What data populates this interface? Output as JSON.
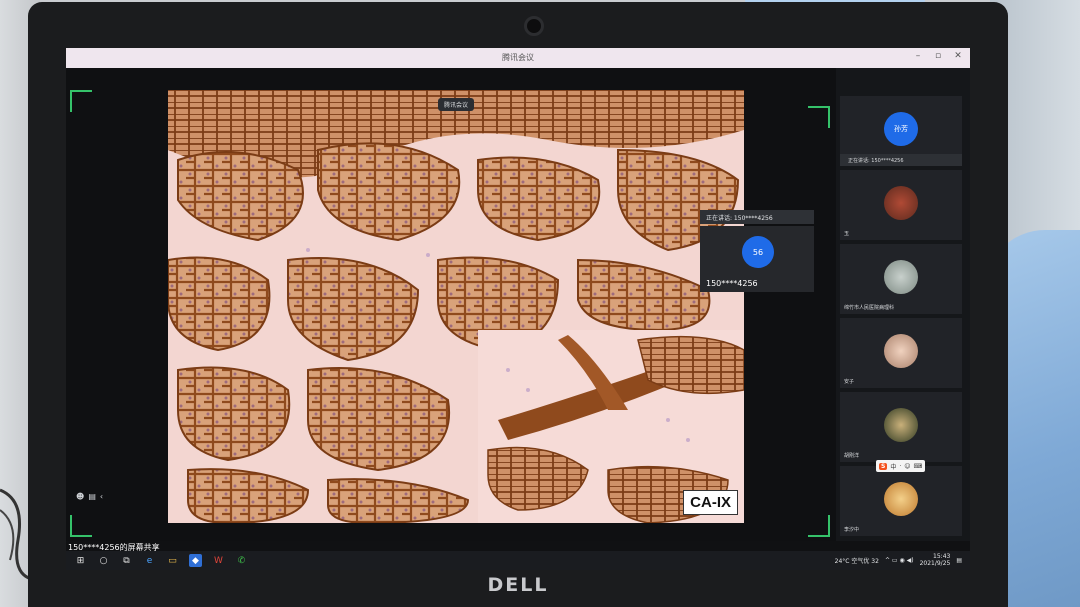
{
  "window": {
    "title": "腾讯会议",
    "controls": [
      "–",
      "▫",
      "✕"
    ]
  },
  "stage": {
    "meeting_chip": "腾讯会议",
    "stain_label": "CA-IX",
    "speaking_bar": "正在讲话: 150****4256",
    "float_tile": {
      "avatar_text": "56",
      "name": "150****4256"
    },
    "left_tools": [
      "☻",
      "▤",
      "‹"
    ]
  },
  "participants": [
    {
      "avatar_text": "孙芳",
      "name": "",
      "speaking": "正在讲话: 150****4256",
      "avatar_color": "#1f6be8"
    },
    {
      "avatar_text": "",
      "name": "玉",
      "speaking": "",
      "avatar_color": "#8a3b2c"
    },
    {
      "avatar_text": "",
      "name": "绵竹市人民医院病理科",
      "speaking": "",
      "avatar_color": "#9aa7a0"
    },
    {
      "avatar_text": "",
      "name": "安子",
      "speaking": "",
      "avatar_color": "#c7a38b"
    },
    {
      "avatar_text": "",
      "name": "胡刚洋",
      "speaking": "",
      "avatar_color": "#3d4a2e"
    },
    {
      "avatar_text": "",
      "name": "李汐中",
      "speaking": "",
      "avatar_color": "#d89b4a"
    }
  ],
  "ime": {
    "logo": "S",
    "items": [
      "中",
      "·",
      "☺",
      "⌨"
    ]
  },
  "share_banner": "150****4256的屏幕共享",
  "taskbar": {
    "apps": [
      "⊞",
      "○",
      "⧉",
      "e",
      "▭",
      "◆",
      "W",
      "✆"
    ],
    "weather": "24°C 空气优 32",
    "time": "15:43",
    "date": "2021/9/25"
  },
  "monitor": {
    "brand": "DELL"
  },
  "colors": {
    "accent_blue": "#1f6be8",
    "frame_green": "#35c26a",
    "stain_brown": "#8f4a1d"
  }
}
